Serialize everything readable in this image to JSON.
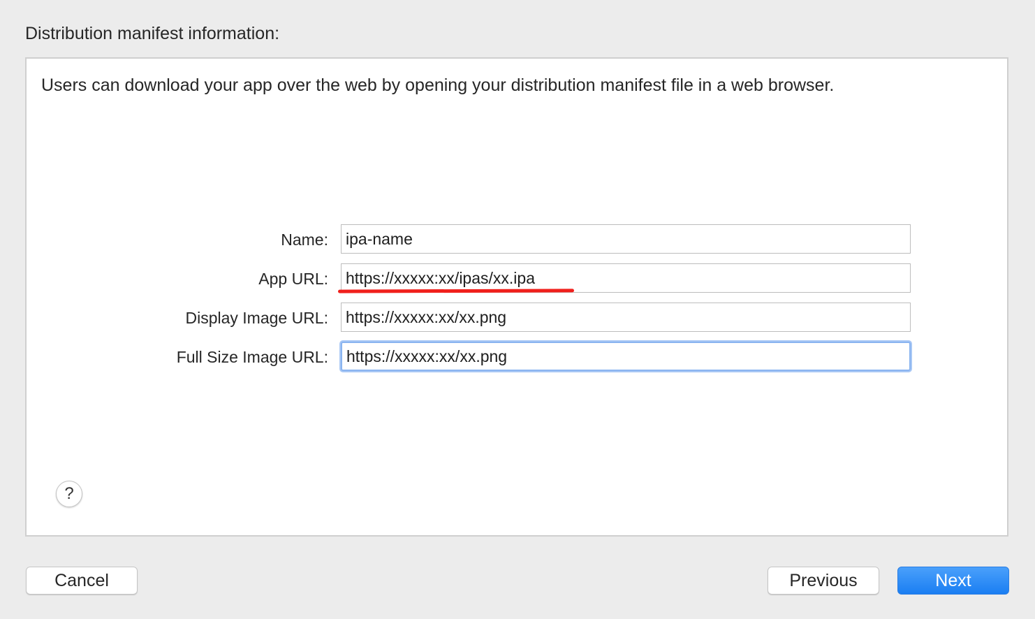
{
  "section_title": "Distribution manifest information:",
  "description": "Users can download your app over the web by opening your distribution manifest file in a web browser.",
  "fields": [
    {
      "label": "Name:",
      "value": "ipa-name"
    },
    {
      "label": "App URL:",
      "value": "https://xxxxx:xx/ipas/xx.ipa"
    },
    {
      "label": "Display Image URL:",
      "value": "https://xxxxx:xx/xx.png"
    },
    {
      "label": "Full Size Image URL:",
      "value": "https://xxxxx:xx/xx.png"
    }
  ],
  "help_button": {
    "label": "?",
    "icon": "question-mark-icon"
  },
  "buttons": {
    "cancel": "Cancel",
    "previous": "Previous",
    "next": "Next"
  },
  "colors": {
    "accent": "#1a7ef2",
    "focus_ring": "#8ab4f0",
    "annotation_underline": "#f0201c"
  }
}
